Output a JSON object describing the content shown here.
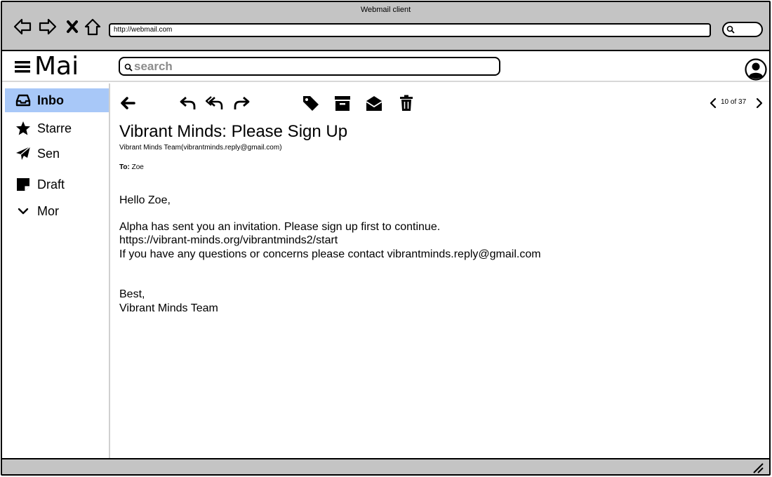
{
  "browser": {
    "title": "Webmail client",
    "url": "http://webmail.com"
  },
  "app": {
    "logo": "Mai",
    "search_placeholder": "search"
  },
  "sidebar": {
    "items": [
      {
        "label": "Inbo",
        "icon": "inbox-icon",
        "active": true
      },
      {
        "label": "Starre",
        "icon": "star-icon",
        "active": false
      },
      {
        "label": "Sen",
        "icon": "send-icon",
        "active": false
      },
      {
        "label": "Draft",
        "icon": "draft-icon",
        "active": false
      },
      {
        "label": "Mor",
        "icon": "chevron-down-icon",
        "active": false
      }
    ]
  },
  "toolbar": {
    "icons": [
      "back-arrow-icon",
      "reply-icon",
      "reply-all-icon",
      "forward-icon",
      "tag-icon",
      "archive-icon",
      "mark-read-icon",
      "trash-icon"
    ]
  },
  "pager": {
    "text": "10 of 37"
  },
  "email": {
    "subject": "Vibrant Minds: Please Sign Up",
    "sender": "Vibrant Minds Team(vibrantminds.reply@gmail.com)",
    "to_label": "To:",
    "to_value": "Zoe",
    "greeting": "Hello Zoe,",
    "line1": "Alpha has sent you an invitation. Please sign up first to continue.",
    "line2": "https://vibrant-minds.org/vibrantminds2/start",
    "line3": "If you have any questions or concerns please contact vibrantminds.reply@gmail.com",
    "signoff": "Best,",
    "signature": "Vibrant Minds Team"
  },
  "colors": {
    "chrome": "#c4c4c4",
    "active_item": "#a8c8f8"
  }
}
